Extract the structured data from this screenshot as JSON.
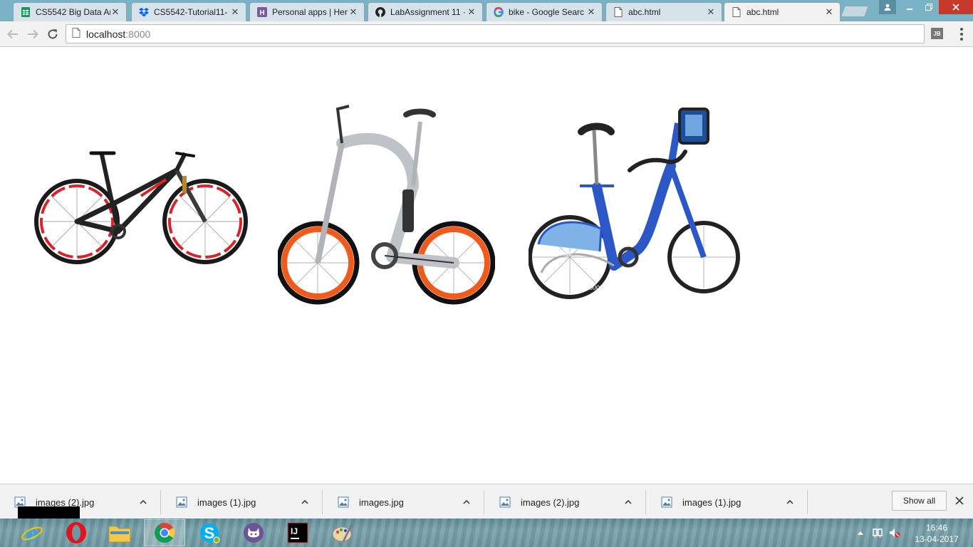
{
  "browser": {
    "tabs": [
      {
        "title": "CS5542 Big Data An",
        "icon": "google-sheets-icon",
        "color": "#0f9d58"
      },
      {
        "title": "CS5542-Tutorial11-",
        "icon": "dropbox-icon",
        "color": "#0061fe"
      },
      {
        "title": "Personal apps | Her",
        "icon": "heroku-icon",
        "color": "#79589f"
      },
      {
        "title": "LabAssignment 11 ·",
        "icon": "github-icon",
        "color": "#222222"
      },
      {
        "title": "bike - Google Searc",
        "icon": "google-icon",
        "color": "#4285f4"
      },
      {
        "title": "abc.html",
        "icon": "page-icon",
        "color": "#666666"
      },
      {
        "title": "abc.html",
        "icon": "page-icon",
        "color": "#666666"
      }
    ],
    "active_tab_index": 6,
    "address": {
      "host": "localhost",
      "port": ":8000"
    },
    "extension_badge": "JB"
  },
  "page": {
    "images": [
      {
        "name": "mountain-bike-image",
        "description_icon": "black-red-full-suspension-bike"
      },
      {
        "name": "e-bike-image",
        "description_icon": "silver-orange-electric-bike"
      },
      {
        "name": "citi-bike-image",
        "description_icon": "blue-citi-bike"
      }
    ],
    "citibike": {
      "brand": "citi bike",
      "number": "00002"
    }
  },
  "downloads": {
    "items": [
      {
        "name": "images (2).jpg"
      },
      {
        "name": "images (1).jpg"
      },
      {
        "name": "images.jpg"
      },
      {
        "name": "images (2).jpg"
      },
      {
        "name": "images (1).jpg"
      }
    ],
    "show_all_label": "Show all"
  },
  "taskbar": {
    "apps": [
      "internet-explorer-icon",
      "opera-icon",
      "file-explorer-icon",
      "chrome-icon",
      "skype-icon",
      "github-desktop-icon",
      "intellij-idea-icon",
      "paint-icon"
    ],
    "active_app": "chrome-icon",
    "clock": {
      "time": "16:46",
      "date": "13-04-2017"
    }
  },
  "colors": {
    "tabstrip": "#7ab3c6",
    "toolbar": "#f2f2f2",
    "citibike_blue": "#2c57c7",
    "ebike_orange": "#f05a1a",
    "mtb_red": "#d8232a"
  }
}
